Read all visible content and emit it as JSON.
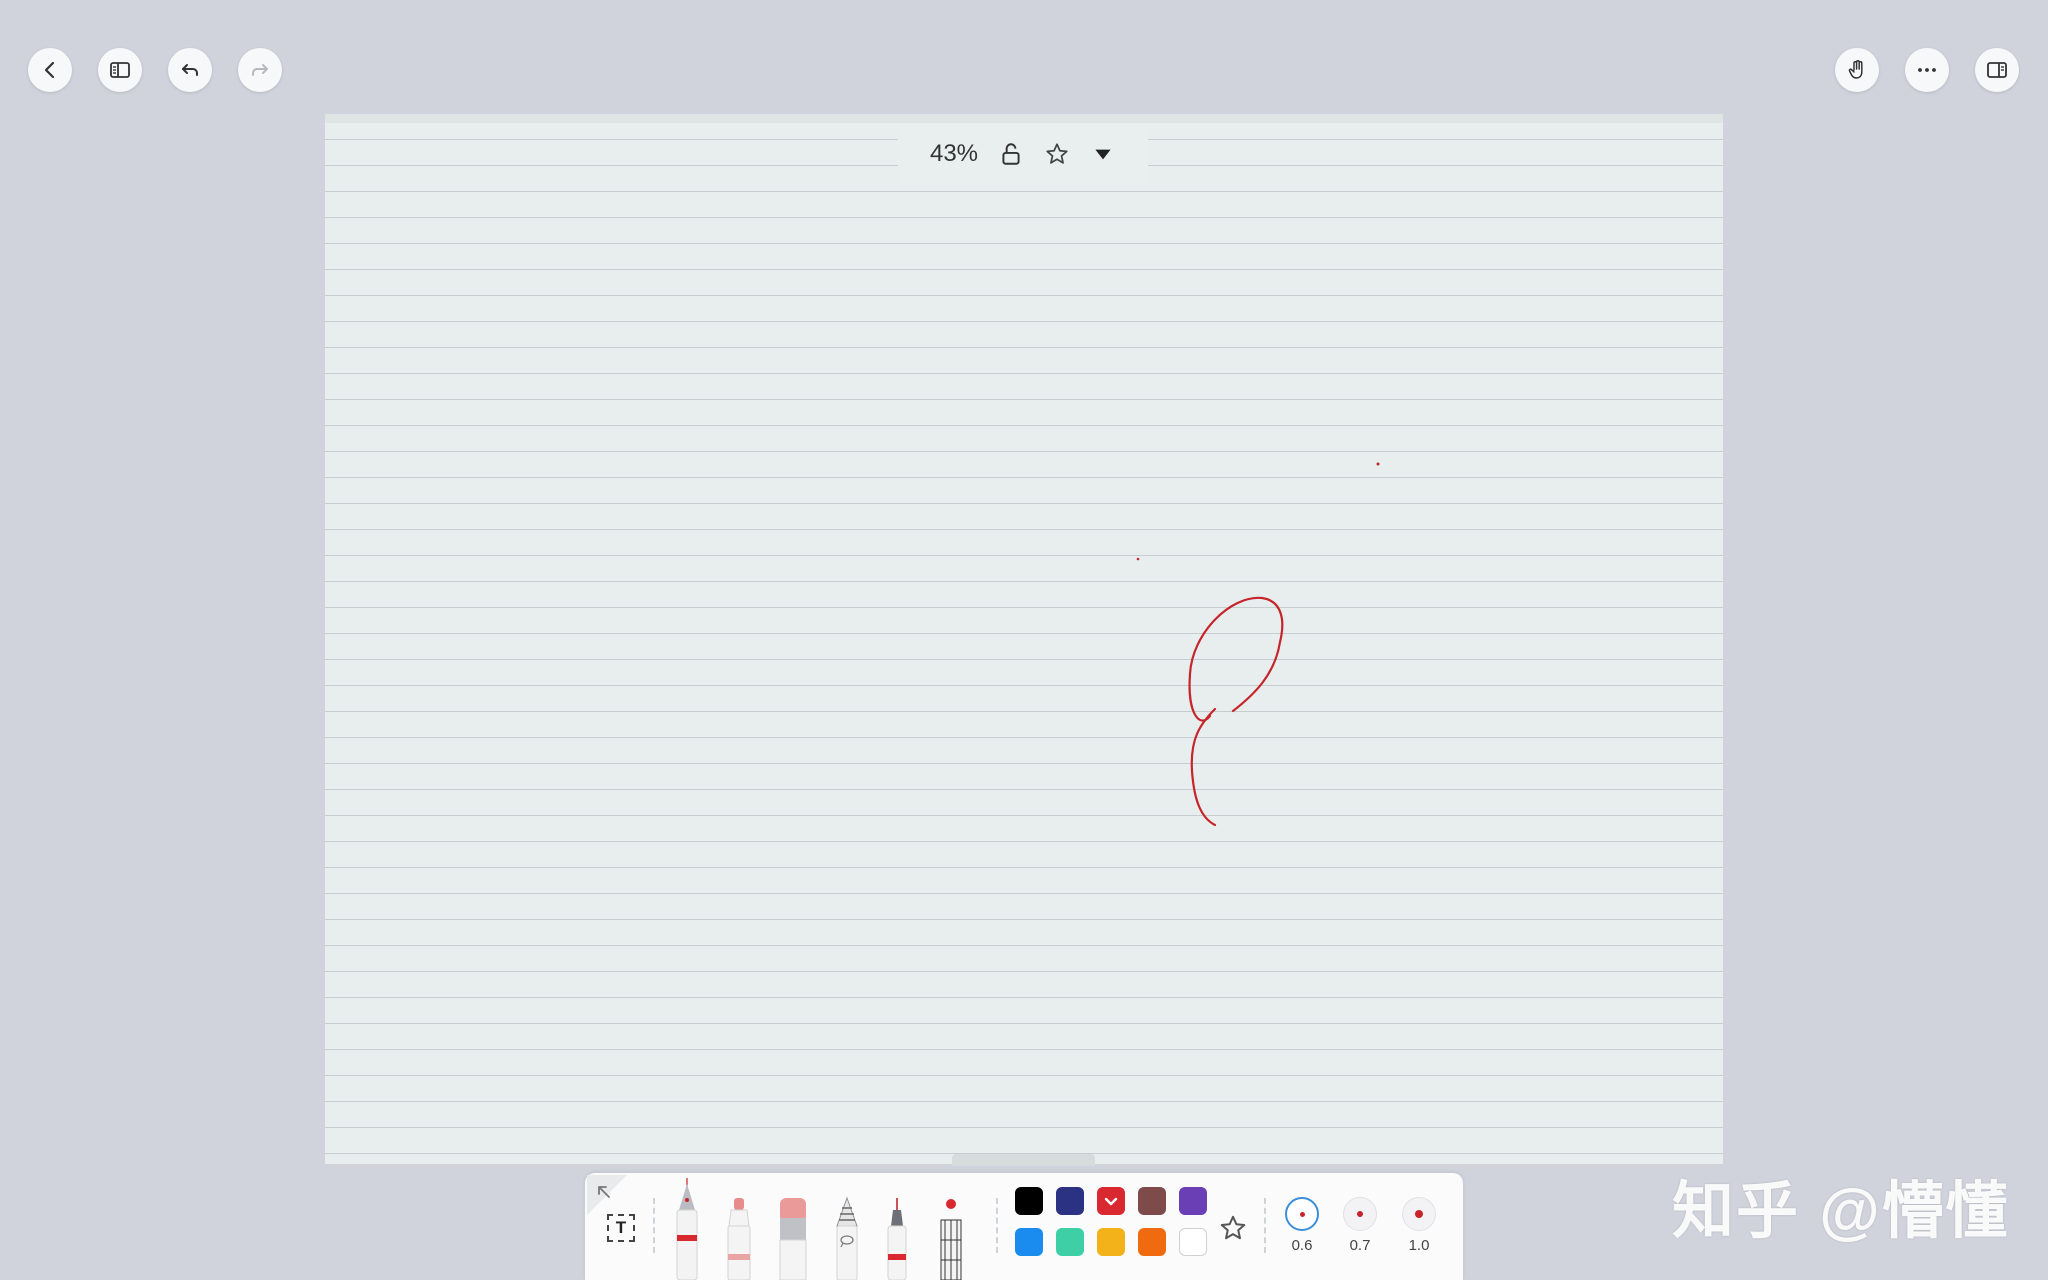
{
  "top_bar": {
    "left_buttons": [
      "back-icon",
      "sidebar-toggle-icon",
      "undo-icon",
      "redo-icon"
    ],
    "right_buttons": [
      "hand-tool-icon",
      "more-icon",
      "right-panel-icon"
    ]
  },
  "zoom_bar": {
    "zoom_level": "43%",
    "icons": [
      "unlock-icon",
      "star-icon",
      "dropdown-triangle-icon"
    ]
  },
  "canvas": {
    "paper_type": "lined",
    "paper_color": "#e8eeee",
    "line_color": "#c5cfcf",
    "ink_color": "#c6252b",
    "strokes": [
      "loop-stroke",
      "dot",
      "dot"
    ]
  },
  "toolbar": {
    "text_tool_label": "T",
    "tools": [
      "fountain-pen",
      "marker",
      "eraser",
      "pencil-lasso",
      "ballpoint-pen",
      "ruler-laser"
    ],
    "colors": {
      "row1": [
        "#000000",
        "#2b3183",
        "#d9282f",
        "#7e4a4a",
        "#6a3fb5"
      ],
      "row2": [
        "#1a8cf0",
        "#3ecfa6",
        "#f3b21a",
        "#f06b0f",
        "#ffffff"
      ],
      "selected": "#d9282f"
    },
    "favorite_icon": "star-icon",
    "sizes": [
      "0.6",
      "0.7",
      "1.0"
    ],
    "selected_size": "0.6"
  },
  "watermark": "知乎 @懵懂"
}
